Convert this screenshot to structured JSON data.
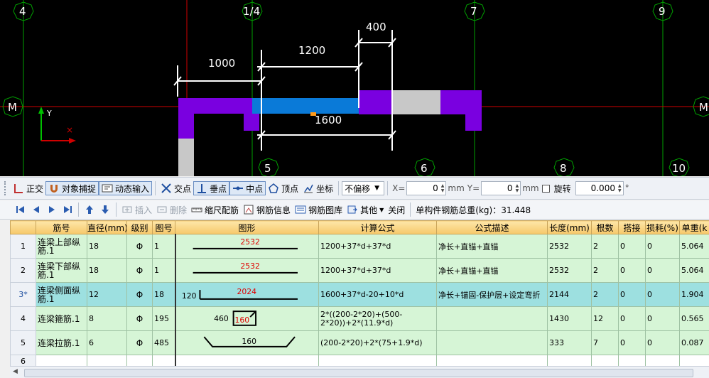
{
  "cad": {
    "top_axes": [
      "4",
      "1/4",
      "7",
      "9"
    ],
    "bottom_axes": [
      "5",
      "6",
      "8",
      "10"
    ],
    "row_axes": [
      "M",
      "M"
    ],
    "dims": [
      "1000",
      "1200",
      "400",
      "1600"
    ],
    "ucs_y": "Y",
    "colors": {
      "beam_purple": "#7a00e0",
      "beam_blue": "#0a7ad8",
      "beam_gray": "#c8c8c8",
      "axis_red": "#d00000",
      "axis_green": "#00a000"
    }
  },
  "toolbar1": {
    "ortho": "正交",
    "snap": "对象捕捉",
    "dynamic": "动态输入",
    "intersect": "交点",
    "perp": "垂点",
    "mid": "中点",
    "vertex": "顶点",
    "coord": "坐标",
    "offset_mode": "不偏移",
    "x_label": "X=",
    "x_value": "0",
    "y_label": "Y=",
    "y_value": "0",
    "unit1": "mm",
    "unit2": "mm",
    "rotate": "旋转",
    "rotate_value": "0.000",
    "degree": "°"
  },
  "toolbar2": {
    "insert": "插入",
    "delete": "删除",
    "scale_bar": "缩尺配筋",
    "bar_info": "钢筋信息",
    "bar_lib": "钢筋图库",
    "other": "其他",
    "close": "关闭",
    "total": "单构件钢筋总重(kg)：31.448"
  },
  "table": {
    "headers": [
      "筋号",
      "直径(mm)",
      "级别",
      "图号",
      "图形",
      "计算公式",
      "公式描述",
      "长度(mm)",
      "根数",
      "搭接",
      "损耗(%)",
      "单重(k"
    ],
    "rows": [
      {
        "no": "1",
        "name": "连梁上部纵筋.1",
        "dia": "18",
        "grade": "Φ",
        "code": "1",
        "shape_a": "",
        "shape_b": "2532",
        "formula": "1200+37*d+37*d",
        "desc": "净长+直锚+直锚",
        "len": "2532",
        "count": "2",
        "lap": "0",
        "loss": "0",
        "weight": "5.064"
      },
      {
        "no": "2",
        "name": "连梁下部纵筋.1",
        "dia": "18",
        "grade": "Φ",
        "code": "1",
        "shape_a": "",
        "shape_b": "2532",
        "formula": "1200+37*d+37*d",
        "desc": "净长+直锚+直锚",
        "len": "2532",
        "count": "2",
        "lap": "0",
        "loss": "0",
        "weight": "5.064"
      },
      {
        "no": "3*",
        "name": "连梁侧面纵筋.1",
        "dia": "12",
        "grade": "Φ",
        "code": "18",
        "shape_a": "120",
        "shape_b": "2024",
        "formula": "1600+37*d-20+10*d",
        "desc": "净长+锚固-保护层+设定弯折",
        "len": "2144",
        "count": "2",
        "lap": "0",
        "loss": "0",
        "weight": "1.904"
      },
      {
        "no": "4",
        "name": "连梁箍筋.1",
        "dia": "8",
        "grade": "Φ",
        "code": "195",
        "shape_a": "460",
        "shape_b": "160",
        "formula": "2*((200-2*20)+(500-2*20))+2*(11.9*d)",
        "desc": "",
        "len": "1430",
        "count": "12",
        "lap": "0",
        "loss": "0",
        "weight": "0.565"
      },
      {
        "no": "5",
        "name": "连梁拉筋.1",
        "dia": "6",
        "grade": "Φ",
        "code": "485",
        "shape_a": "",
        "shape_b": "160",
        "formula": "(200-2*20)+2*(75+1.9*d)",
        "desc": "",
        "len": "333",
        "count": "7",
        "lap": "0",
        "loss": "0",
        "weight": "0.087"
      }
    ],
    "empty_row_no": "6"
  }
}
